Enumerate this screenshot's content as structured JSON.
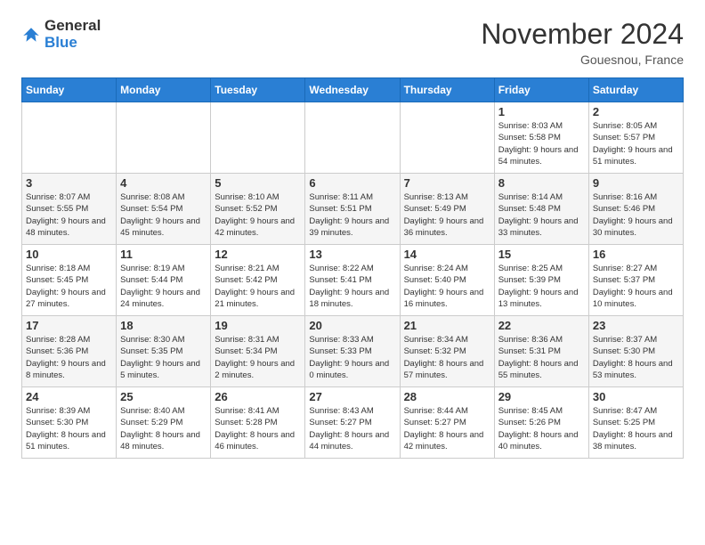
{
  "header": {
    "logo_general": "General",
    "logo_blue": "Blue",
    "month_title": "November 2024",
    "location": "Gouesnou, France"
  },
  "days_of_week": [
    "Sunday",
    "Monday",
    "Tuesday",
    "Wednesday",
    "Thursday",
    "Friday",
    "Saturday"
  ],
  "rows": [
    [
      {
        "day": "",
        "info": ""
      },
      {
        "day": "",
        "info": ""
      },
      {
        "day": "",
        "info": ""
      },
      {
        "day": "",
        "info": ""
      },
      {
        "day": "",
        "info": ""
      },
      {
        "day": "1",
        "info": "Sunrise: 8:03 AM\nSunset: 5:58 PM\nDaylight: 9 hours\nand 54 minutes."
      },
      {
        "day": "2",
        "info": "Sunrise: 8:05 AM\nSunset: 5:57 PM\nDaylight: 9 hours\nand 51 minutes."
      }
    ],
    [
      {
        "day": "3",
        "info": "Sunrise: 8:07 AM\nSunset: 5:55 PM\nDaylight: 9 hours\nand 48 minutes."
      },
      {
        "day": "4",
        "info": "Sunrise: 8:08 AM\nSunset: 5:54 PM\nDaylight: 9 hours\nand 45 minutes."
      },
      {
        "day": "5",
        "info": "Sunrise: 8:10 AM\nSunset: 5:52 PM\nDaylight: 9 hours\nand 42 minutes."
      },
      {
        "day": "6",
        "info": "Sunrise: 8:11 AM\nSunset: 5:51 PM\nDaylight: 9 hours\nand 39 minutes."
      },
      {
        "day": "7",
        "info": "Sunrise: 8:13 AM\nSunset: 5:49 PM\nDaylight: 9 hours\nand 36 minutes."
      },
      {
        "day": "8",
        "info": "Sunrise: 8:14 AM\nSunset: 5:48 PM\nDaylight: 9 hours\nand 33 minutes."
      },
      {
        "day": "9",
        "info": "Sunrise: 8:16 AM\nSunset: 5:46 PM\nDaylight: 9 hours\nand 30 minutes."
      }
    ],
    [
      {
        "day": "10",
        "info": "Sunrise: 8:18 AM\nSunset: 5:45 PM\nDaylight: 9 hours\nand 27 minutes."
      },
      {
        "day": "11",
        "info": "Sunrise: 8:19 AM\nSunset: 5:44 PM\nDaylight: 9 hours\nand 24 minutes."
      },
      {
        "day": "12",
        "info": "Sunrise: 8:21 AM\nSunset: 5:42 PM\nDaylight: 9 hours\nand 21 minutes."
      },
      {
        "day": "13",
        "info": "Sunrise: 8:22 AM\nSunset: 5:41 PM\nDaylight: 9 hours\nand 18 minutes."
      },
      {
        "day": "14",
        "info": "Sunrise: 8:24 AM\nSunset: 5:40 PM\nDaylight: 9 hours\nand 16 minutes."
      },
      {
        "day": "15",
        "info": "Sunrise: 8:25 AM\nSunset: 5:39 PM\nDaylight: 9 hours\nand 13 minutes."
      },
      {
        "day": "16",
        "info": "Sunrise: 8:27 AM\nSunset: 5:37 PM\nDaylight: 9 hours\nand 10 minutes."
      }
    ],
    [
      {
        "day": "17",
        "info": "Sunrise: 8:28 AM\nSunset: 5:36 PM\nDaylight: 9 hours\nand 8 minutes."
      },
      {
        "day": "18",
        "info": "Sunrise: 8:30 AM\nSunset: 5:35 PM\nDaylight: 9 hours\nand 5 minutes."
      },
      {
        "day": "19",
        "info": "Sunrise: 8:31 AM\nSunset: 5:34 PM\nDaylight: 9 hours\nand 2 minutes."
      },
      {
        "day": "20",
        "info": "Sunrise: 8:33 AM\nSunset: 5:33 PM\nDaylight: 9 hours\nand 0 minutes."
      },
      {
        "day": "21",
        "info": "Sunrise: 8:34 AM\nSunset: 5:32 PM\nDaylight: 8 hours\nand 57 minutes."
      },
      {
        "day": "22",
        "info": "Sunrise: 8:36 AM\nSunset: 5:31 PM\nDaylight: 8 hours\nand 55 minutes."
      },
      {
        "day": "23",
        "info": "Sunrise: 8:37 AM\nSunset: 5:30 PM\nDaylight: 8 hours\nand 53 minutes."
      }
    ],
    [
      {
        "day": "24",
        "info": "Sunrise: 8:39 AM\nSunset: 5:30 PM\nDaylight: 8 hours\nand 51 minutes."
      },
      {
        "day": "25",
        "info": "Sunrise: 8:40 AM\nSunset: 5:29 PM\nDaylight: 8 hours\nand 48 minutes."
      },
      {
        "day": "26",
        "info": "Sunrise: 8:41 AM\nSunset: 5:28 PM\nDaylight: 8 hours\nand 46 minutes."
      },
      {
        "day": "27",
        "info": "Sunrise: 8:43 AM\nSunset: 5:27 PM\nDaylight: 8 hours\nand 44 minutes."
      },
      {
        "day": "28",
        "info": "Sunrise: 8:44 AM\nSunset: 5:27 PM\nDaylight: 8 hours\nand 42 minutes."
      },
      {
        "day": "29",
        "info": "Sunrise: 8:45 AM\nSunset: 5:26 PM\nDaylight: 8 hours\nand 40 minutes."
      },
      {
        "day": "30",
        "info": "Sunrise: 8:47 AM\nSunset: 5:25 PM\nDaylight: 8 hours\nand 38 minutes."
      }
    ]
  ]
}
